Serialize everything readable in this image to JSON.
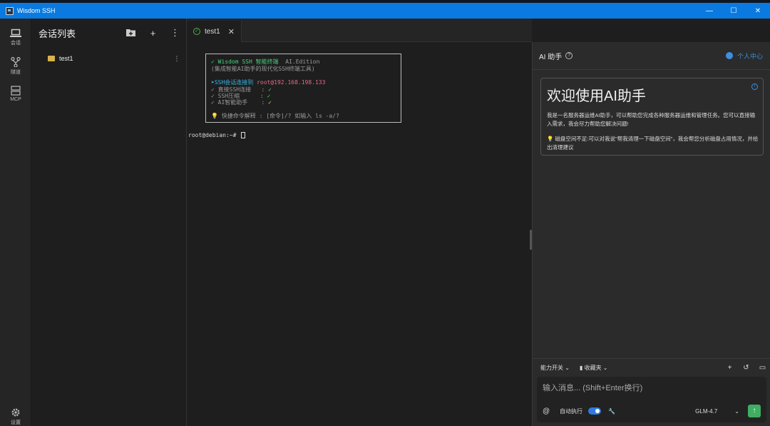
{
  "window": {
    "title": "Wisdom SSH",
    "minimize": "—",
    "maximize": "☐",
    "close": "✕"
  },
  "leftbar": {
    "items": [
      {
        "label": "会话",
        "icon": "laptop-icon"
      },
      {
        "label": "隧道",
        "icon": "tunnel-icon"
      },
      {
        "label": "MCP",
        "icon": "server-icon"
      },
      {
        "label": "设置",
        "icon": "gear-icon"
      }
    ]
  },
  "sessions": {
    "title": "会话列表",
    "new_folder_icon": "folder-plus-icon",
    "add_icon": "+",
    "more_icon": "⋮",
    "items": [
      {
        "label": "test1",
        "more": "⋮"
      }
    ]
  },
  "tabs": [
    {
      "label": "test1",
      "status": "connected",
      "close": "✕"
    }
  ],
  "terminal": {
    "banner_title": "✓ Wisdom SSH 智能终端",
    "banner_edition": "AI.Edition",
    "banner_subtitle": "(集成智能AI助手的现代化SSH终端工具)",
    "connected_label": "➤SSH会话连接到",
    "connected_host": "root@192.168.198.133",
    "features": [
      {
        "label": "✓ 直接SSH连接   : ",
        "mark": "✓"
      },
      {
        "label": "✓ SSH压缩      : ",
        "mark": "✓"
      },
      {
        "label": "✓ AI智能助手    : ",
        "mark": "✓"
      }
    ],
    "tip": "💡 快捷命令解释 : [命令]/? 如输入 ls -a/?",
    "prompt": "root@debian:~#"
  },
  "ai": {
    "title": "AI 助手",
    "help_icon": "?",
    "user_center": "个人中心",
    "welcome_title": "欢迎使用AI助手",
    "welcome_desc": "我是一名服务器运维AI助手，可以帮助您完成各种服务器运维和管理任务。您可以直接输入需求，我会尽力帮助您解决问题!",
    "tip_label": "磁盘空间不足:",
    "tip_text": "可以对我说\"帮我清理一下磁盘空间\"，我会帮您分析磁盘占用情况，并给出清理建议",
    "toolbar": {
      "capability": "能力开关 ⌄",
      "favorites": "收藏夹 ⌄"
    },
    "input_placeholder": "输入消息... (Shift+Enter换行)",
    "at_label": "@",
    "auto_exec": "自动执行",
    "auto_exec_on": true,
    "model": "GLM-4.7",
    "send": "↑",
    "accent": "#3d8fe0"
  }
}
